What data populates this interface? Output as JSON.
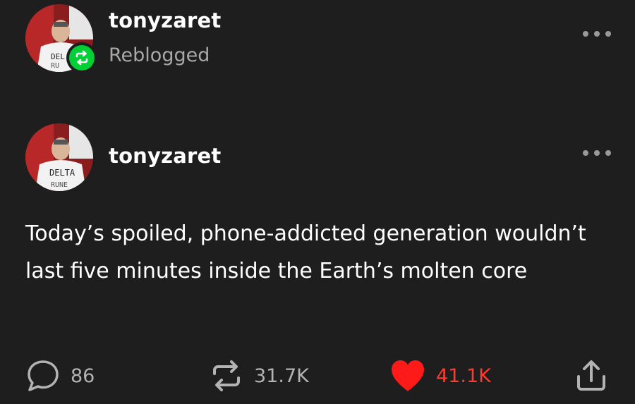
{
  "reblog_header": {
    "username": "tonyzaret",
    "status": "Reblogged"
  },
  "post": {
    "author": "tonyzaret",
    "text": "Today’s spoiled, phone-addicted generation wouldn’t last five minutes inside the Earth’s molten core"
  },
  "footer": {
    "replies": "86",
    "reblogs": "31.7K",
    "likes": "41.1K",
    "liked": true
  },
  "colors": {
    "background": "#1e1e1e",
    "reblog_green": "#00cf35",
    "like_red": "#ff3b30",
    "muted_text": "#a8a8a8"
  },
  "icons": {
    "reblog_badge": "reblog-icon",
    "more": "more-icon",
    "reply": "reply-icon",
    "reblog": "reblog-icon",
    "like": "heart-icon",
    "share": "share-icon"
  }
}
